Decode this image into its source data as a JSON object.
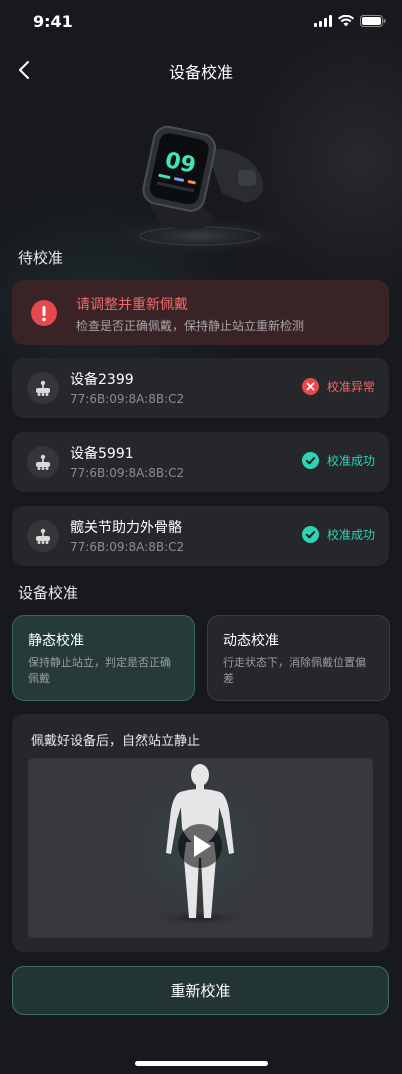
{
  "status_bar": {
    "time": "9:41"
  },
  "nav": {
    "title": "设备校准"
  },
  "watch_preview": {
    "display_value": "09"
  },
  "pending": {
    "section_title": "待校准",
    "alert": {
      "title": "请调整并重新佩戴",
      "subtitle": "检查是否正确佩戴，保持静止站立重新检测"
    },
    "devices": [
      {
        "name": "设备2399",
        "mac": "77:6B:09:8A:8B:C2",
        "status": "校准异常",
        "status_type": "error"
      },
      {
        "name": "设备5991",
        "mac": "77:6B:09:8A:8B:C2",
        "status": "校准成功",
        "status_type": "success"
      },
      {
        "name": "髋关节助力外骨骼",
        "mac": "77:6B:09:8A:8B:C2",
        "status": "校准成功",
        "status_type": "success"
      }
    ]
  },
  "calibration": {
    "section_title": "设备校准",
    "modes": [
      {
        "title": "静态校准",
        "desc": "保持静止站立，判定是否正确佩戴",
        "selected": true
      },
      {
        "title": "动态校准",
        "desc": "行走状态下，消除佩戴位置偏差",
        "selected": false
      }
    ],
    "guide_text": "佩戴好设备后，自然站立静止"
  },
  "actions": {
    "recalibrate_label": "重新校准"
  },
  "colors": {
    "background": "#17191d",
    "card": "#25272b",
    "error": "#e5484d",
    "success": "#2ed3b7",
    "accent_border": "#3e6f69"
  }
}
